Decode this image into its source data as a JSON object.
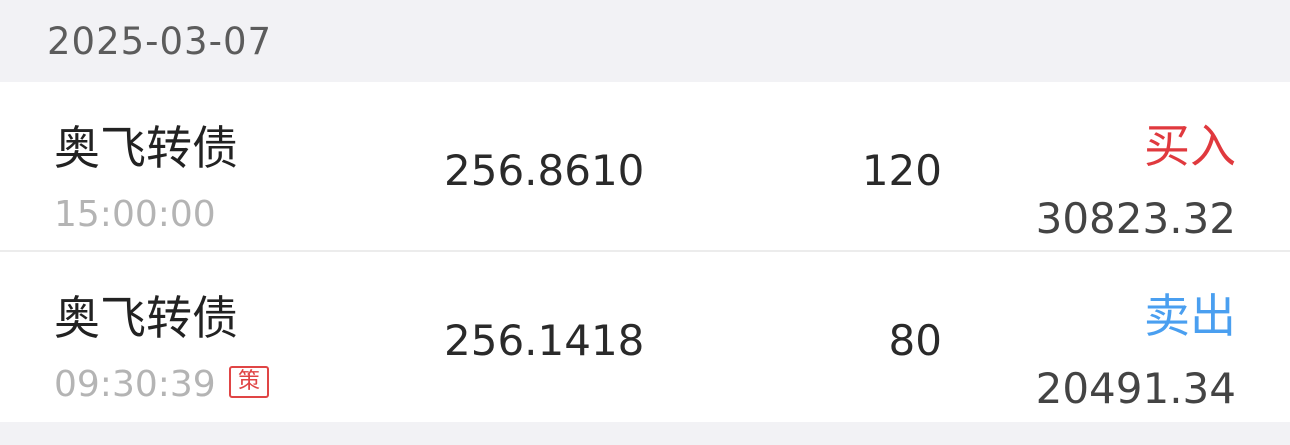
{
  "date_header": "2025-03-07",
  "colors": {
    "buy": "#e0393e",
    "sell": "#4a9ff0",
    "badge": "#e04545"
  },
  "trades": [
    {
      "name": "奥飞转债",
      "time": "15:00:00",
      "price": "256.8610",
      "quantity": "120",
      "side": "买入",
      "amount": "30823.32",
      "badge": ""
    },
    {
      "name": "奥飞转债",
      "time": "09:30:39",
      "price": "256.1418",
      "quantity": "80",
      "side": "卖出",
      "amount": "20491.34",
      "badge": "策"
    }
  ]
}
